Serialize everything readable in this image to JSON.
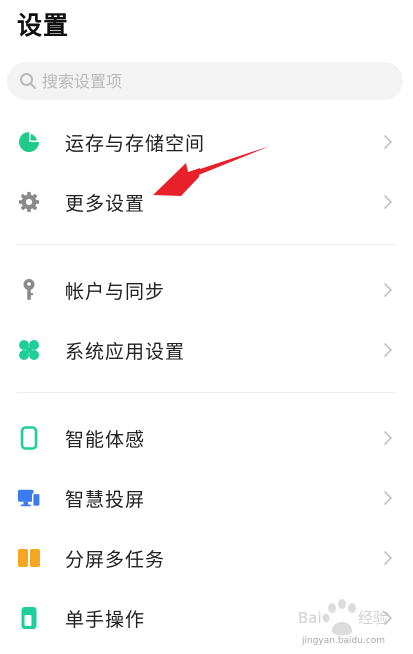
{
  "header": {
    "title": "设置"
  },
  "search": {
    "placeholder": "搜索设置项",
    "icon": "search-icon"
  },
  "groups": [
    {
      "items": [
        {
          "label": "运存与存储空间",
          "icon": "pie-chart-icon",
          "icon_color": "#21c98b"
        },
        {
          "label": "更多设置",
          "icon": "gear-icon",
          "icon_color": "#8a8a8a"
        }
      ]
    },
    {
      "items": [
        {
          "label": "帐户与同步",
          "icon": "key-icon",
          "icon_color": "#8a8a8a"
        },
        {
          "label": "系统应用设置",
          "icon": "four-petal-icon",
          "icon_color": "#1fcf9a"
        }
      ]
    },
    {
      "items": [
        {
          "label": "智能体感",
          "icon": "phone-outline-icon",
          "icon_color": "#1fcf9a"
        },
        {
          "label": "智慧投屏",
          "icon": "screen-cast-icon",
          "icon_color": "#3d7bf0"
        },
        {
          "label": "分屏多任务",
          "icon": "split-screen-icon",
          "icon_color": "#f5a623"
        },
        {
          "label": "单手操作",
          "icon": "one-hand-icon",
          "icon_color": "#1fcf9a"
        }
      ]
    }
  ],
  "colors": {
    "annotation_arrow": "#e8202a",
    "divider": "#ececec",
    "chevron": "#c4c4c4"
  },
  "watermark": {
    "text": "jingyan.baidu.com"
  }
}
